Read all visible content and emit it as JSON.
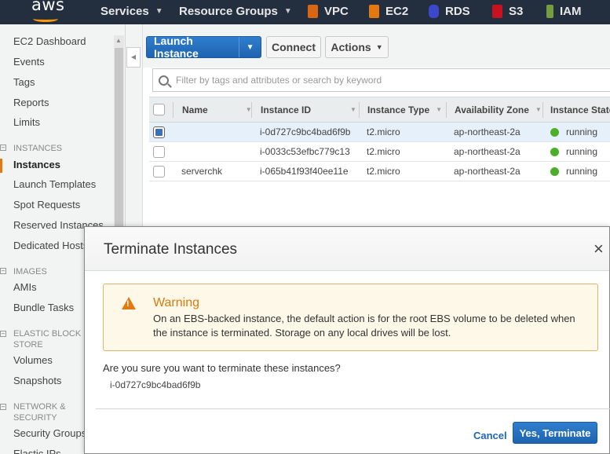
{
  "nav": {
    "logo": "aws",
    "services": "Services",
    "resource_groups": "Resource Groups",
    "shortcuts": [
      {
        "label": "VPC",
        "icon": "vpc-icon",
        "color": "#d86613"
      },
      {
        "label": "EC2",
        "icon": "ec2-icon",
        "color": "#e47911"
      },
      {
        "label": "RDS",
        "icon": "rds-icon",
        "color": "#3b48cc"
      },
      {
        "label": "S3",
        "icon": "s3-icon",
        "color": "#c7131f"
      },
      {
        "label": "IAM",
        "icon": "iam-icon",
        "color": "#759c3e"
      }
    ]
  },
  "sidebar": {
    "top_links": [
      "EC2 Dashboard",
      "Events",
      "Tags",
      "Reports",
      "Limits"
    ],
    "sections": [
      {
        "heading": "INSTANCES",
        "items": [
          "Instances",
          "Launch Templates",
          "Spot Requests",
          "Reserved Instances",
          "Dedicated Hosts"
        ]
      },
      {
        "heading": "IMAGES",
        "items": [
          "AMIs",
          "Bundle Tasks"
        ]
      },
      {
        "heading": "ELASTIC BLOCK STORE",
        "items": [
          "Volumes",
          "Snapshots"
        ]
      },
      {
        "heading": "NETWORK & SECURITY",
        "items": [
          "Security Groups",
          "Elastic IPs"
        ]
      }
    ],
    "active": "Instances"
  },
  "toolbar": {
    "launch": "Launch Instance",
    "connect": "Connect",
    "actions": "Actions"
  },
  "search": {
    "placeholder": "Filter by tags and attributes or search by keyword"
  },
  "table": {
    "columns": [
      "Name",
      "Instance ID",
      "Instance Type",
      "Availability Zone",
      "Instance State"
    ],
    "rows": [
      {
        "name": "",
        "id": "i-0d727c9bc4bad6f9b",
        "type": "t2.micro",
        "zone": "ap-northeast-2a",
        "state": "running",
        "selected": true
      },
      {
        "name": "",
        "id": "i-0033c53efbc779c13",
        "type": "t2.micro",
        "zone": "ap-northeast-2a",
        "state": "running",
        "selected": false
      },
      {
        "name": "serverchk",
        "id": "i-065b41f93f40ee11e",
        "type": "t2.micro",
        "zone": "ap-northeast-2a",
        "state": "running",
        "selected": false
      }
    ]
  },
  "modal": {
    "title": "Terminate Instances",
    "close": "×",
    "warning_title": "Warning",
    "warning_text": "On an EBS-backed instance, the default action is for the root EBS volume to be deleted when the instance is terminated. Storage on any local drives will be lost.",
    "question": "Are you sure you want to terminate these instances?",
    "instance_id": "i-0d727c9bc4bad6f9b",
    "cancel": "Cancel",
    "confirm": "Yes, Terminate"
  }
}
